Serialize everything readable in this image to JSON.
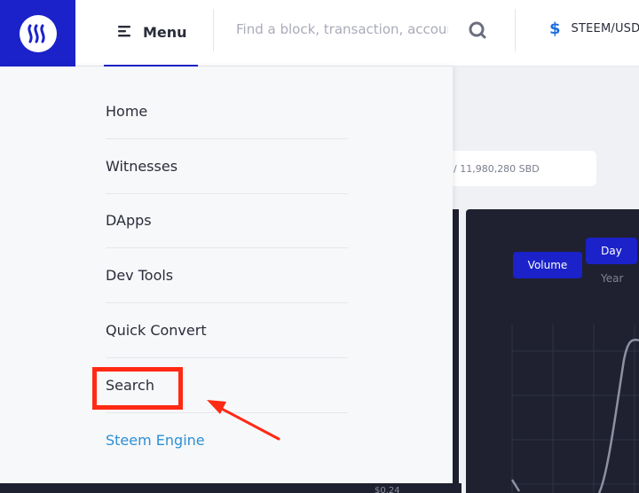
{
  "header": {
    "logo_icon": "steem-logo-icon",
    "menu_label": "Menu",
    "search_placeholder": "Find a block, transaction, account...",
    "price_pair": "STEEM/USD"
  },
  "background": {
    "supply_text": "/ 11,980,280 SBD",
    "chart_buttons": {
      "volume": "Volume",
      "day": "Day",
      "year": "Year"
    },
    "axis_tick": "$0.24"
  },
  "menu": {
    "items": [
      {
        "label": "Home"
      },
      {
        "label": "Witnesses"
      },
      {
        "label": "DApps"
      },
      {
        "label": "Dev Tools"
      },
      {
        "label": "Quick Convert"
      },
      {
        "label": "Search"
      },
      {
        "label": "Steem Engine"
      }
    ]
  },
  "colors": {
    "brand": "#1b22c9",
    "highlight": "#ff2a13",
    "link": "#2d8fd4",
    "chart_bg": "#1f2130"
  }
}
